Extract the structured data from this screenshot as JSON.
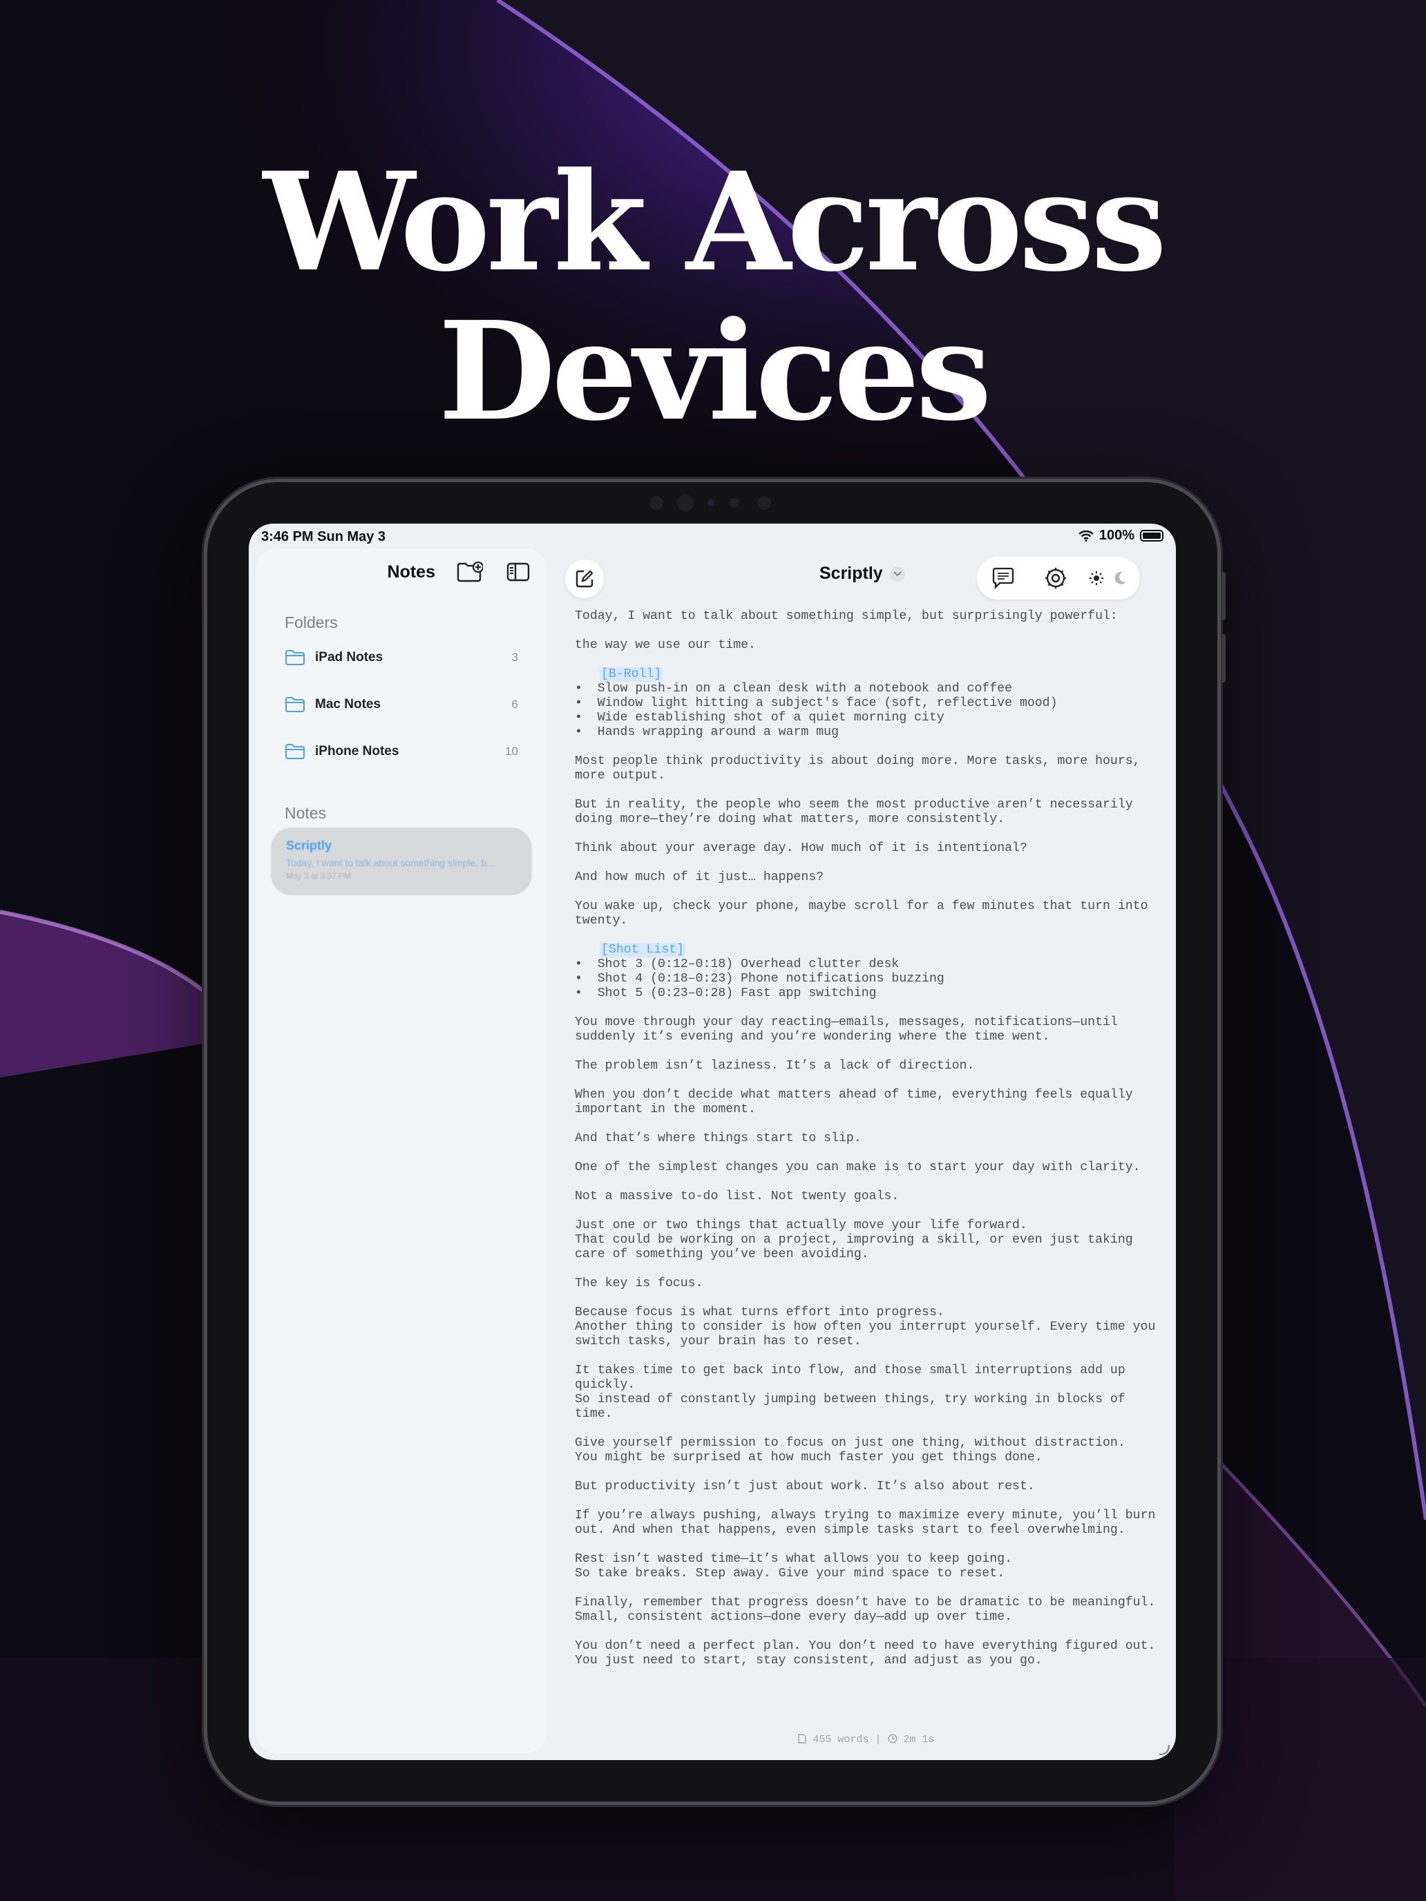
{
  "headline": "Work Across Devices",
  "status_bar": {
    "time": "3:46 PM   Sun May 3",
    "battery": "100%"
  },
  "sidebar": {
    "title": "Notes",
    "folders_label": "Folders",
    "folders": [
      {
        "name": "iPad Notes",
        "count": "3"
      },
      {
        "name": "Mac Notes",
        "count": "6"
      },
      {
        "name": "iPhone Notes",
        "count": "10"
      }
    ],
    "notes_label": "Notes",
    "note": {
      "title": "Scriptly",
      "preview": "Today, I want to talk about something simple, b...",
      "date": "May 3 at 3:37 PM"
    }
  },
  "editor": {
    "title": "Scriptly",
    "p1": "Today, I want to talk about something simple, but surprisingly powerful:",
    "p2": "the way we use our time.",
    "tag1": "[B-Roll]",
    "broll": [
      "•  Slow push-in on a clean desk with a notebook and coffee",
      "•  Window light hitting a subject's face (soft, reflective mood)",
      "•  Wide establishing shot of a quiet morning city",
      "•  Hands wrapping around a warm mug"
    ],
    "p3": "Most people think productivity is about doing more. More tasks, more hours, more output.",
    "p4": "But in reality, the people who seem the most productive aren’t necessarily doing more—they’re doing what matters, more consistently.",
    "p5": "Think about your average day. How much of it is intentional?",
    "p6": "And how much of it just… happens?",
    "p7": "You wake up, check your phone, maybe scroll for a few minutes that turn into twenty.",
    "tag2": "[Shot List]",
    "shots": [
      "•  Shot 3 (0:12–0:18) Overhead clutter desk",
      "•  Shot 4 (0:18–0:23) Phone notifications buzzing",
      "•  Shot 5 (0:23–0:28) Fast app switching"
    ],
    "p8": "You move through your day reacting—emails, messages, notifications—until suddenly it’s evening and you’re wondering where the time went.",
    "p9": "The problem isn’t laziness. It’s a lack of direction.",
    "p10": "When you don’t decide what matters ahead of time, everything feels equally important in the moment.",
    "p11": "And that’s where things start to slip.",
    "p12": "One of the simplest changes you can make is to start your day with clarity.",
    "p13": "Not a massive to-do list. Not twenty goals.",
    "p14a": "Just one or two things that actually move your life forward.",
    "p14b": "That could be working on a project, improving a skill, or even just taking care of something you’ve been avoiding.",
    "p15": "The key is focus.",
    "p16a": "Because focus is what turns effort into progress.",
    "p16b": "Another thing to consider is how often you interrupt yourself. Every time you switch tasks, your brain has to reset.",
    "p17a": "It takes time to get back into flow, and those small interruptions add up quickly.",
    "p17b": "So instead of constantly jumping between things, try working in blocks of time.",
    "p18a": "Give yourself permission to focus on just one thing, without distraction.",
    "p18b": "You might be surprised at how much faster you get things done.",
    "p19": "But productivity isn’t just about work. It’s also about rest.",
    "p20": "If you’re always pushing, always trying to maximize every minute, you’ll burn out. And when that happens, even simple tasks start to feel overwhelming.",
    "p21a": "Rest isn’t wasted time—it’s what allows you to keep going.",
    "p21b": "So take breaks. Step away. Give your mind space to reset.",
    "p22a": "Finally, remember that progress doesn’t have to be dramatic to be meaningful.",
    "p22b": "Small, consistent actions—done every day—add up over time.",
    "p23a": "You don’t need a perfect plan. You don’t need to have everything figured out.",
    "p23b": "You just need to start, stay consistent, and adjust as you go.",
    "word_count": "455 words",
    "separator": "|",
    "duration": "2m 1s"
  },
  "colors": {
    "accent": "#4d9fe8",
    "tag_bg": "#d6e8fb",
    "screen_bg": "#eef1f3"
  },
  "icons": [
    "folder-add-icon",
    "sidebar-toggle-icon",
    "compose-icon",
    "teleprompter-icon",
    "settings-icon",
    "sun-icon",
    "moon-icon",
    "wifi-icon",
    "battery-icon",
    "folder-icon",
    "document-icon",
    "clock-icon"
  ]
}
